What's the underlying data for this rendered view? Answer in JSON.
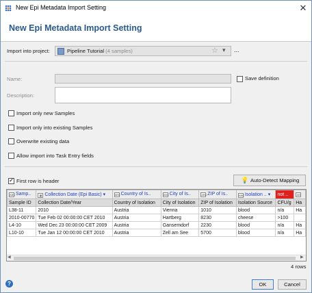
{
  "window": {
    "title": "New Epi Metadata Import Setting"
  },
  "header": {
    "title": "New Epi Metadata Import Setting"
  },
  "project": {
    "label": "Import into project:",
    "name": "Pipeline Tutorial",
    "detail": "(4 samples)",
    "more": "..."
  },
  "form": {
    "name_label": "Name:",
    "name_value": "",
    "save_definition": "Save definition",
    "save_checked": false,
    "description_label": "Description:",
    "description_value": ""
  },
  "options": [
    {
      "label": "Import only new Samples",
      "checked": false
    },
    {
      "label": "Import only into existing Samples",
      "checked": false
    },
    {
      "label": "Overwrite existing data",
      "checked": false
    },
    {
      "label": "Allow import into Task Entry fields",
      "checked": false
    }
  ],
  "first_row_header": {
    "label": "First row is header",
    "checked": true
  },
  "auto_detect": "Auto-Detect Mapping",
  "grid": {
    "mapping": [
      "Samp..",
      "Collection Date (Epi Basic)",
      "Country of Is..",
      "City of Is..",
      "ZIP of Is..",
      "Isolation ..",
      "not ..",
      ""
    ],
    "header": [
      "Sample ID",
      "Collection Date/Year",
      "Country of Isolation",
      "City of Isolation",
      "ZIP of Isolation",
      "Isolation Source",
      "CFU/g",
      "Ha"
    ],
    "rows": [
      [
        "L38-11",
        "2010",
        "Austria",
        "Vienna",
        "1010",
        "blood",
        "n/a",
        "Ha"
      ],
      [
        "2010-00770",
        "Tue Feb 02 00:00:00 CET 2010",
        "Austria",
        "Hartberg",
        "8230",
        "cheese",
        ">100",
        ""
      ],
      [
        "L4-10",
        "Wed Dec 23 00:00:00 CET 2009",
        "Austria",
        "Gansemdorf",
        "2230",
        "blood",
        "n/a",
        "Ha"
      ],
      [
        "L10-10",
        "Tue Jan 12 00:00:00 CET 2010",
        "Austria",
        "Zell am See",
        "5700",
        "blood",
        "n/a",
        "Ha"
      ]
    ],
    "row_count": "4 rows"
  },
  "buttons": {
    "ok": "OK",
    "cancel": "Cancel"
  },
  "colors": {
    "accent": "#2a5a8c",
    "not_mapped": "#e0201c",
    "mapping_text": "#1f3fbf"
  }
}
